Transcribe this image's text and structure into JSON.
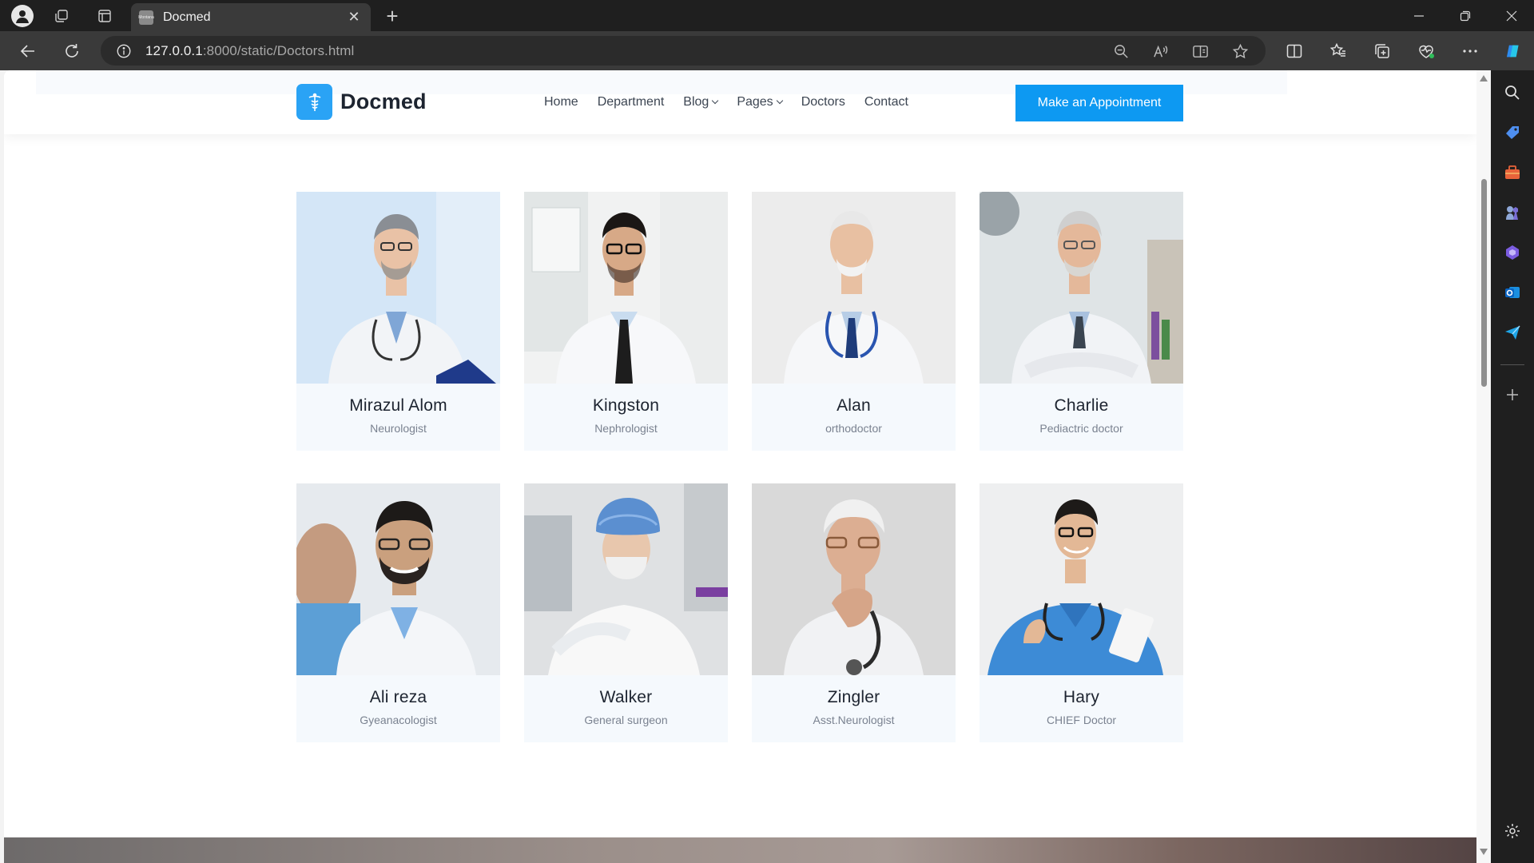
{
  "browser": {
    "tab_title": "Docmed",
    "tab_favicon_text": "Montana",
    "url_host": "127.0.0.1",
    "url_rest": ":8000/static/Doctors.html"
  },
  "site": {
    "logo_text": "Docmed",
    "nav": [
      {
        "label": "Home"
      },
      {
        "label": "Department"
      },
      {
        "label": "Blog"
      },
      {
        "label": "Pages"
      },
      {
        "label": "Doctors"
      },
      {
        "label": "Contact"
      }
    ],
    "cta_label": "Make an Appointment"
  },
  "doctors": [
    {
      "name": "Mirazul Alom",
      "role": "Neurologist"
    },
    {
      "name": "Kingston",
      "role": "Nephrologist"
    },
    {
      "name": "Alan",
      "role": "orthodoctor"
    },
    {
      "name": "Charlie",
      "role": "Pediactric doctor"
    },
    {
      "name": "Ali reza",
      "role": "Gyeanacologist"
    },
    {
      "name": "Walker",
      "role": "General surgeon"
    },
    {
      "name": "Zingler",
      "role": "Asst.Neurologist"
    },
    {
      "name": "Hary",
      "role": "CHIEF Doctor"
    }
  ],
  "colors": {
    "accent": "#0d99f2",
    "logo_bg": "#2aa3f5",
    "card_bg": "#f5f9fd"
  }
}
